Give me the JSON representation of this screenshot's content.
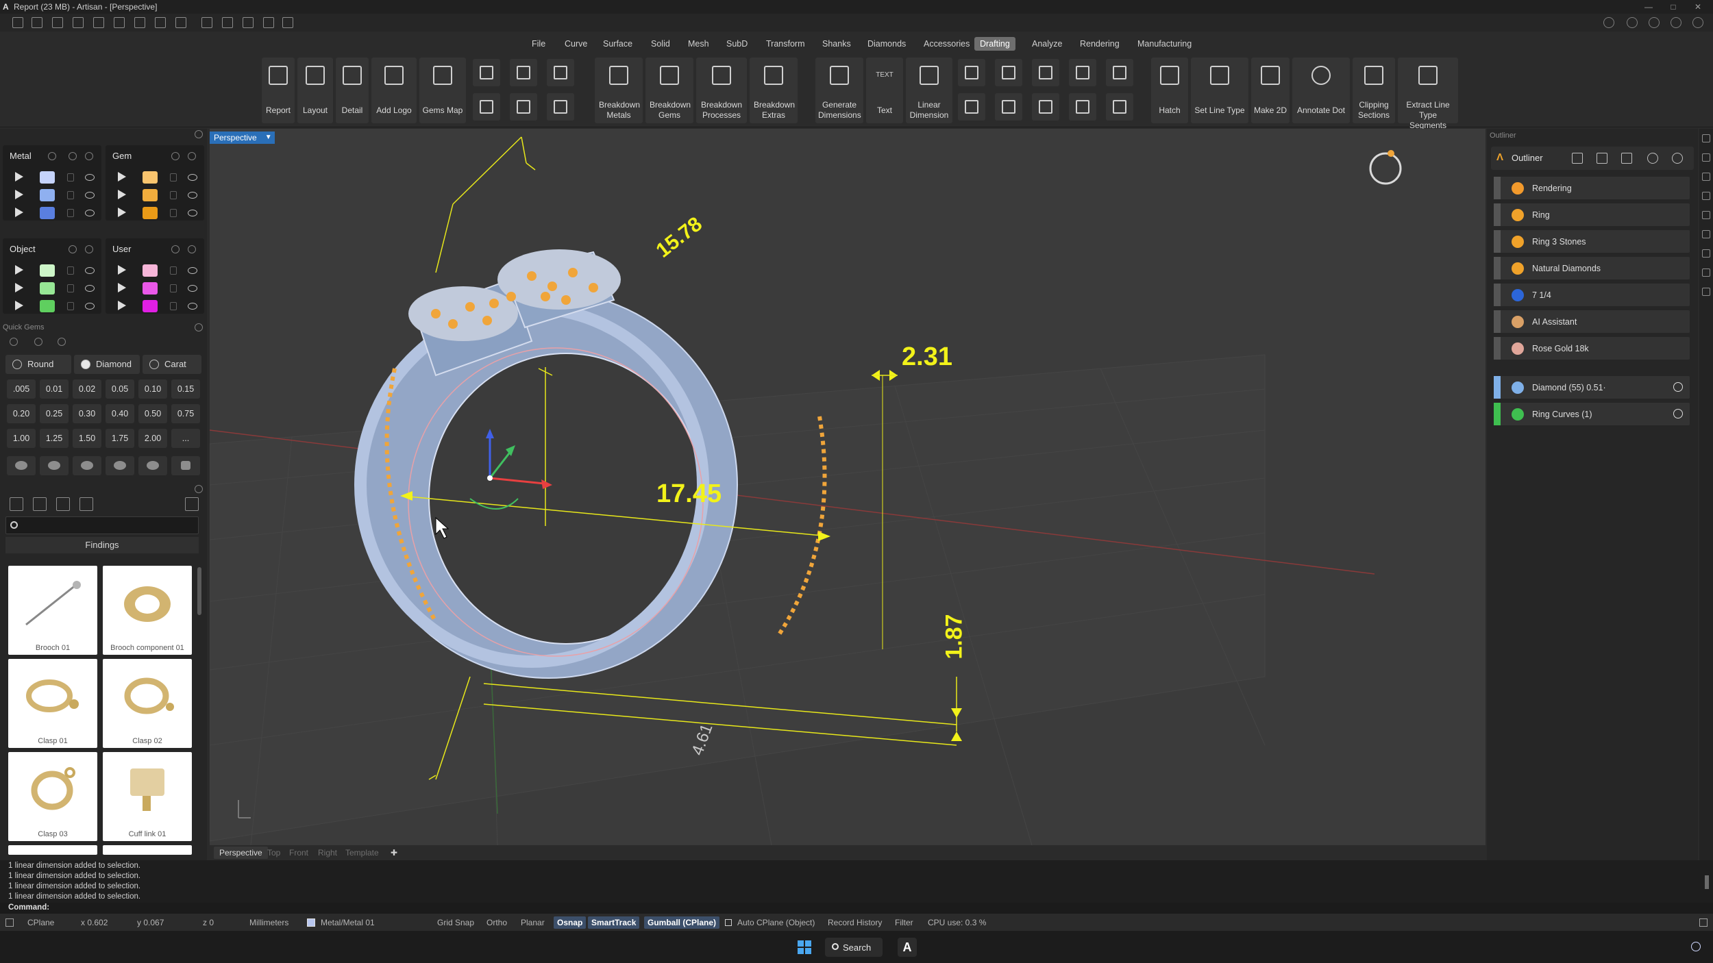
{
  "window": {
    "title": "Report (23 MB) - Artisan - [Perspective]",
    "app_logo": "A"
  },
  "menu": {
    "items": [
      "File",
      "Curve",
      "Surface",
      "Solid",
      "Mesh",
      "SubD",
      "Transform",
      "Shanks",
      "Diamonds",
      "Accessories",
      "Drafting",
      "Analyze",
      "Rendering",
      "Manufacturing"
    ],
    "active": "Drafting"
  },
  "ribbon": {
    "report": "Report",
    "layout": "Layout",
    "detail": "Detail",
    "add_logo": "Add Logo",
    "gems_map": "Gems Map",
    "breakdown_metals": "Breakdown Metals",
    "breakdown_gems": "Breakdown Gems",
    "breakdown_processes": "Breakdown Processes",
    "breakdown_extras": "Breakdown Extras",
    "generate_dimensions": "Generate Dimensions",
    "text": "Text",
    "linear_dimension": "Linear Dimension",
    "hatch": "Hatch",
    "set_line_type": "Set Line Type",
    "make_2d": "Make 2D",
    "annotate_dot": "Annotate Dot",
    "clipping_sections": "Clipping Sections",
    "extract_line_type_segments": "Extract Line Type Segments"
  },
  "layers": {
    "metal": {
      "title": "Metal",
      "swatches": [
        "#c5d3fb",
        "#8fb0f0",
        "#5a7fe0"
      ]
    },
    "gem": {
      "title": "Gem",
      "swatches": [
        "#f8c46e",
        "#f1ad3d",
        "#e99a17"
      ]
    },
    "object": {
      "title": "Object",
      "swatches": [
        "#cdf5c8",
        "#97e795",
        "#5fcf5f"
      ]
    },
    "user": {
      "title": "User",
      "swatches": [
        "#f6b5d8",
        "#ea58e8",
        "#e01fe3"
      ]
    }
  },
  "quick_gems": {
    "title": "Quick Gems",
    "shape": "Round",
    "type": "Diamond",
    "unit": "Carat",
    "sizes": [
      ".005",
      "0.01",
      "0.02",
      "0.05",
      "0.10",
      "0.15",
      "0.20",
      "0.25",
      "0.30",
      "0.40",
      "0.50",
      "0.75",
      "1.00",
      "1.25",
      "1.50",
      "1.75",
      "2.00",
      "..."
    ]
  },
  "library": {
    "search_placeholder": "",
    "category": "Findings",
    "items": [
      "Brooch 01",
      "Brooch component 01",
      "Clasp 01",
      "Clasp 02",
      "Clasp 03",
      "Cuff link 01"
    ]
  },
  "viewport": {
    "label": "Perspective",
    "dimensions": [
      "15.78",
      "2.31",
      "17.45",
      "1.87",
      "4.61"
    ]
  },
  "view_tabs": [
    "Perspective",
    "Top",
    "Front",
    "Right",
    "Template"
  ],
  "outliner": {
    "panel_title": "Outliner",
    "header": "Outliner",
    "items": [
      {
        "label": "Rendering",
        "color": "#f29a2c"
      },
      {
        "label": "Ring",
        "color": "#f0a22a"
      },
      {
        "label": "Ring 3 Stones",
        "color": "#f0a22a"
      },
      {
        "label": "Natural Diamonds",
        "color": "#f0a22a"
      },
      {
        "label": "7 1/4",
        "color": "#2c66d9"
      },
      {
        "label": "AI Assistant",
        "color": "#d9a066"
      },
      {
        "label": "Rose Gold 18k",
        "color": "#e0a69a"
      },
      {
        "label": "Diamond (55) 0.51·",
        "color": "#7fb0e8"
      },
      {
        "label": "Ring Curves (1)",
        "color": "#3fbf50"
      }
    ]
  },
  "command": {
    "history": [
      "1 linear dimension added to selection.",
      "1 linear dimension added to selection.",
      "1 linear dimension added to selection.",
      "1 linear dimension added to selection."
    ],
    "prompt": "Command:"
  },
  "status": {
    "cplane": "CPlane",
    "x": "x 0.602",
    "y": "y 0.067",
    "z": "z 0",
    "units": "Millimeters",
    "layer": "Metal/Metal 01",
    "grid_snap": "Grid Snap",
    "ortho": "Ortho",
    "planar": "Planar",
    "osnap": "Osnap",
    "smarttrack": "SmartTrack",
    "gumball": "Gumball (CPlane)",
    "auto_cplane": "Auto CPlane (Object)",
    "record_history": "Record History",
    "filter": "Filter",
    "cpu": "CPU use: 0.3 %"
  },
  "taskbar": {
    "search": "Search",
    "app": "A"
  }
}
